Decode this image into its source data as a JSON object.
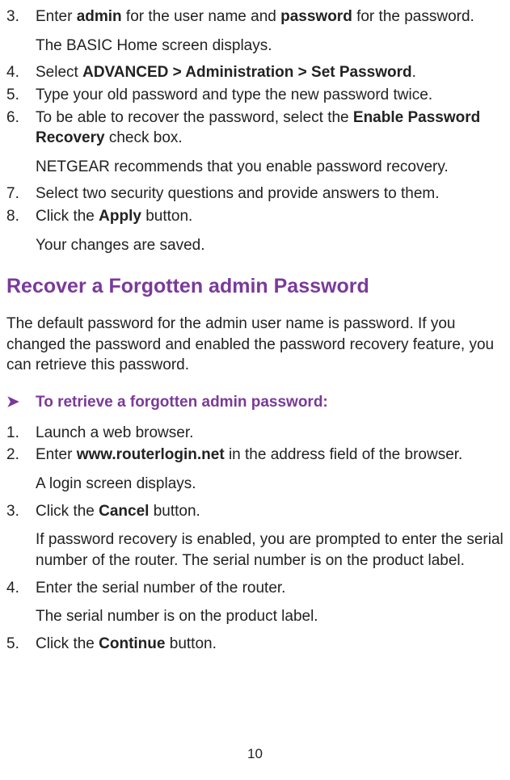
{
  "list1": {
    "items": [
      {
        "num": "3.",
        "line": {
          "pre": "Enter ",
          "b1": "admin",
          "mid": " for the user name and ",
          "b2": "password",
          "post": " for the password."
        },
        "sub": "The BASIC Home screen displays."
      },
      {
        "num": "4.",
        "line": {
          "pre": "Select ",
          "b1": "ADVANCED > Administration > Set Password",
          "post": "."
        }
      },
      {
        "num": "5.",
        "line": {
          "plain": "Type your old password and type the new password twice."
        }
      },
      {
        "num": "6.",
        "line": {
          "pre": "To be able to recover the password, select the ",
          "b1": "Enable Password Recovery",
          "post": " check box."
        },
        "sub": "NETGEAR recommends that you enable password recovery."
      },
      {
        "num": "7.",
        "line": {
          "plain": "Select two security questions and provide answers to them."
        }
      },
      {
        "num": "8.",
        "line": {
          "pre": "Click the ",
          "b1": "Apply",
          "post": " button."
        },
        "sub": "Your changes are saved."
      }
    ]
  },
  "section_heading": "Recover a Forgotten admin Password",
  "intro": "The default password for the admin user name is password. If you changed the password and enabled the password recovery feature, you can retrieve this password.",
  "task_arrow": "➤",
  "task_title": "To retrieve a forgotten admin password:",
  "list2": {
    "items": [
      {
        "num": "1.",
        "line": {
          "plain": "Launch a web browser."
        }
      },
      {
        "num": "2.",
        "line": {
          "pre": "Enter ",
          "b1": "www.routerlogin.net",
          "post": " in the address field of the browser."
        },
        "sub": "A login screen displays."
      },
      {
        "num": "3.",
        "line": {
          "pre": "Click the ",
          "b1": "Cancel",
          "post": " button."
        },
        "sub": "If password recovery is enabled, you are prompted to enter the serial number of the router. The serial number is on the product label."
      },
      {
        "num": "4.",
        "line": {
          "plain": "Enter the serial number of the router."
        },
        "sub": "The serial number is on the product label."
      },
      {
        "num": "5.",
        "line": {
          "pre": "Click the ",
          "b1": "Continue",
          "post": " button."
        }
      }
    ]
  },
  "page_number": "10"
}
